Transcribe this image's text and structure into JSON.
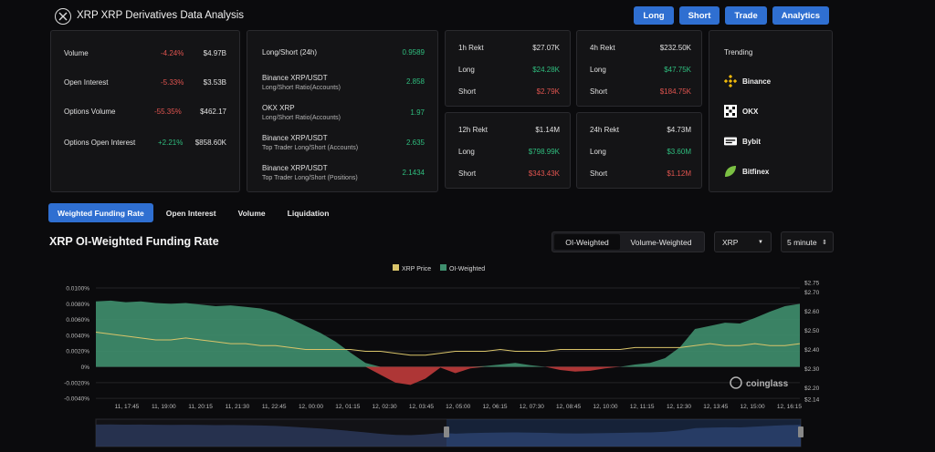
{
  "header": {
    "title": "XRP XRP Derivatives Data Analysis",
    "nav": [
      "Long",
      "Short",
      "Trade",
      "Analytics"
    ]
  },
  "overview": [
    {
      "label": "Volume",
      "change": "-4.24%",
      "value": "$4.97B",
      "trend": "down"
    },
    {
      "label": "Open Interest",
      "change": "-5.33%",
      "value": "$3.53B",
      "trend": "down"
    },
    {
      "label": "Options Volume",
      "change": "-55.35%",
      "value": "$462.17",
      "trend": "down"
    },
    {
      "label": "Options Open Interest",
      "change": "+2.21%",
      "value": "$858.60K",
      "trend": "up"
    }
  ],
  "ratios": [
    {
      "label": "Long/Short (24h)",
      "sub": "",
      "value": "0.9589"
    },
    {
      "label": "Binance XRP/USDT",
      "sub": "Long/Short Ratio(Accounts)",
      "value": "2.858"
    },
    {
      "label": "OKX XRP",
      "sub": "Long/Short Ratio(Accounts)",
      "value": "1.97"
    },
    {
      "label": "Binance XRP/USDT",
      "sub": "Top Trader Long/Short (Accounts)",
      "value": "2.635"
    },
    {
      "label": "Binance XRP/USDT",
      "sub": "Top Trader Long/Short (Positions)",
      "value": "2.1434"
    }
  ],
  "rekt": [
    {
      "title": "1h Rekt",
      "total": "$27.07K",
      "long": "$24.28K",
      "short": "$2.79K"
    },
    {
      "title": "4h Rekt",
      "total": "$232.50K",
      "long": "$47.75K",
      "short": "$184.75K"
    },
    {
      "title": "12h Rekt",
      "total": "$1.14M",
      "long": "$798.99K",
      "short": "$343.43K"
    },
    {
      "title": "24h Rekt",
      "total": "$4.73M",
      "long": "$3.60M",
      "short": "$1.12M"
    }
  ],
  "rekt_labels": {
    "long": "Long",
    "short": "Short"
  },
  "trending": {
    "title": "Trending",
    "items": [
      "Binance",
      "OKX",
      "Bybit",
      "Bitfinex"
    ]
  },
  "tabs": [
    "Weighted Funding Rate",
    "Open Interest",
    "Volume",
    "Liquidation"
  ],
  "chart_header": {
    "title": "XRP OI-Weighted Funding Rate",
    "seg_on": "OI-Weighted",
    "seg_off": "Volume-Weighted",
    "coin": "XRP",
    "interval": "5 minute"
  },
  "watermark": "coinglass",
  "colors": {
    "accent": "#2f6fd1",
    "positive": "#3f8f6e",
    "negative": "#c03b3b",
    "price": "#d9c46a"
  },
  "chart_data": {
    "type": "area",
    "legend": [
      "XRP Price",
      "OI-Weighted"
    ],
    "x_ticks": [
      "11, 17:45",
      "11, 19:00",
      "11, 20:15",
      "11, 21:30",
      "11, 22:45",
      "12, 00:00",
      "12, 01:15",
      "12, 02:30",
      "12, 03:45",
      "12, 05:00",
      "12, 06:15",
      "12, 07:30",
      "12, 08:45",
      "12, 10:00",
      "12, 11:15",
      "12, 12:30",
      "12, 13:45",
      "12, 15:00",
      "12, 16:15"
    ],
    "y_left_ticks": [
      "0.0100%",
      "0.0080%",
      "0.0060%",
      "0.0040%",
      "0.0020%",
      "0%",
      "-0.0020%",
      "-0.0040%"
    ],
    "y_left_values": [
      0.01,
      0.008,
      0.006,
      0.004,
      0.002,
      0,
      -0.002,
      -0.004
    ],
    "y_right_ticks": [
      "$2.75",
      "$2.70",
      "$2.60",
      "$2.50",
      "$2.40",
      "$2.30",
      "$2.20",
      "$2.14"
    ],
    "y_right_values": [
      2.75,
      2.7,
      2.6,
      2.5,
      2.4,
      2.3,
      2.2,
      2.14
    ],
    "ylim_left": [
      -0.0041,
      0.0107
    ],
    "ylim_right": [
      2.14,
      2.75
    ],
    "funding_rate": [
      0.0083,
      0.0084,
      0.0082,
      0.0083,
      0.0081,
      0.008,
      0.0081,
      0.0079,
      0.0077,
      0.0078,
      0.0076,
      0.0074,
      0.0069,
      0.0061,
      0.0052,
      0.0043,
      0.0032,
      0.0018,
      0.0005,
      -0.001,
      -0.002,
      -0.0023,
      -0.0015,
      -0.0001,
      -0.0008,
      -0.0002,
      0.0001,
      0.0003,
      0.0005,
      0.0002,
      0.0,
      -0.0004,
      -0.0006,
      -0.0005,
      -0.0002,
      0.0,
      0.0003,
      0.0005,
      0.0011,
      0.0025,
      0.0048,
      0.0052,
      0.0056,
      0.0055,
      0.0062,
      0.007,
      0.0077,
      0.008
    ],
    "price": [
      2.49,
      2.48,
      2.47,
      2.46,
      2.45,
      2.45,
      2.46,
      2.45,
      2.44,
      2.43,
      2.43,
      2.42,
      2.42,
      2.41,
      2.4,
      2.4,
      2.4,
      2.4,
      2.39,
      2.39,
      2.38,
      2.37,
      2.37,
      2.38,
      2.39,
      2.39,
      2.39,
      2.4,
      2.39,
      2.39,
      2.39,
      2.4,
      2.4,
      2.4,
      2.4,
      2.4,
      2.41,
      2.41,
      2.41,
      2.41,
      2.42,
      2.43,
      2.42,
      2.42,
      2.43,
      2.42,
      2.42,
      2.43
    ]
  }
}
